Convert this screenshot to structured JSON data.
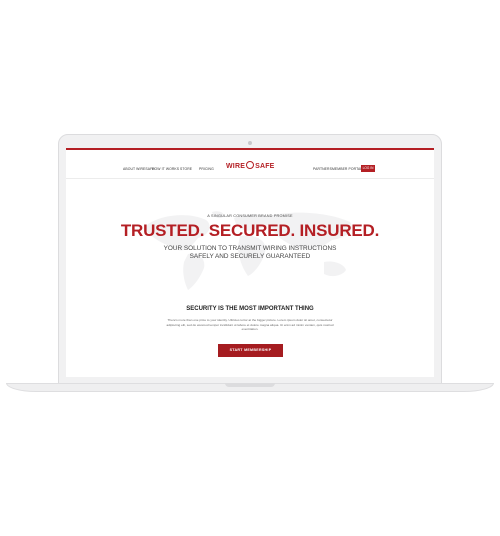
{
  "nav": {
    "left_links": [
      "ABOUT WIRESAFE",
      "HOW IT WORKS",
      "STORE",
      "PRICING"
    ],
    "right_links": [
      "PARTNERS",
      "MEMBER PORTAL"
    ],
    "login_label": "LOG IN"
  },
  "logo": {
    "left": "WIRE",
    "right": "SAFE"
  },
  "hero": {
    "eyebrow": "A SINGULAR CONSUMER BRAND PROMISE",
    "title": "TRUSTED. SECURED. INSURED.",
    "subtitle_line1": "YOUR SOLUTION TO TRANSMIT WIRING INSTRUCTIONS",
    "subtitle_line2": "SAFELY AND SECURELY GUARANTEED"
  },
  "section": {
    "title": "SECURITY IS THE MOST IMPORTANT THING",
    "body": "There's more than one price to your identity. Ultricies tortor at the bigger picture. Lorem ipsum dolor sit amet, consectetur adipiscing elit, sed do eiusmod tempor incididunt ut labore et dolore magna aliqua. Ut enim ad minim veniam, quis nostrud exercitation."
  },
  "cta": {
    "label": "START MEMBERSHIP"
  },
  "colors": {
    "brand": "#b41f24",
    "text": "#333333",
    "background": "#ffffff"
  },
  "icons": {
    "logo": "shield-icon"
  }
}
